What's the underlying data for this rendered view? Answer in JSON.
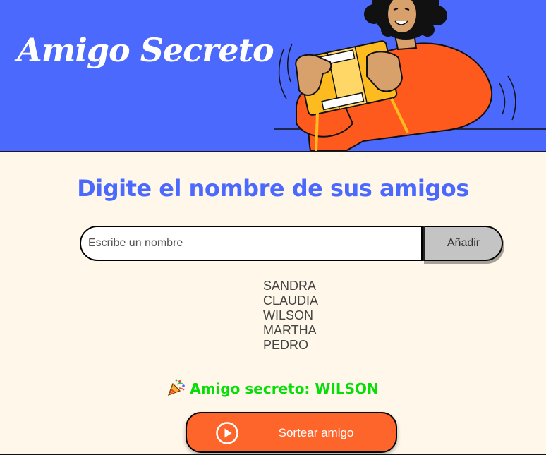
{
  "header": {
    "title": "Amigo Secreto",
    "illustration": "person-opening-gift-box",
    "background_color": "#4B69FD"
  },
  "main": {
    "title": "Digite el nombre de sus amigos",
    "title_color": "#4B69FD",
    "background_color": "#FFF8EA"
  },
  "input": {
    "placeholder": "Escribe un nombre",
    "value": ""
  },
  "add_button": {
    "label": "Añadir"
  },
  "friends": [
    "SANDRA",
    "CLAUDIA",
    "WILSON",
    "MARTHA",
    "PEDRO"
  ],
  "result": {
    "icon": "party-popper-icon",
    "text": "Amigo secreto: WILSON",
    "color": "#05DF05"
  },
  "draw_button": {
    "label": "Sortear amigo",
    "icon": "play-icon",
    "color": "#FE652B"
  }
}
